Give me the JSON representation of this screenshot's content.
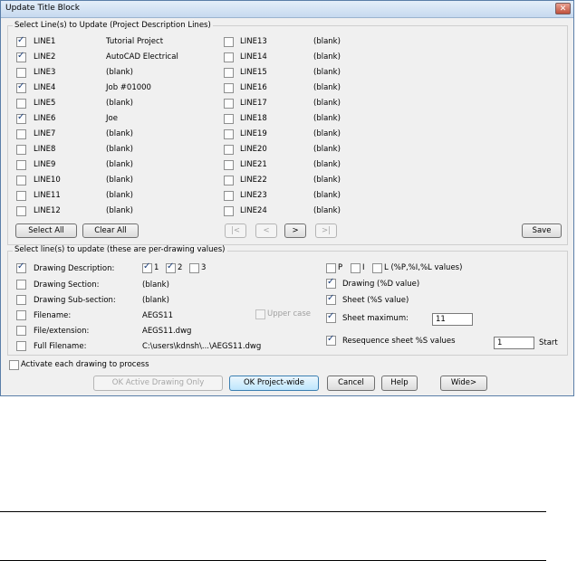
{
  "window": {
    "title": "Update Title Block",
    "close_label": "✕"
  },
  "project_group": {
    "label": "Select Line(s) to Update (Project Description Lines)",
    "left_lines": [
      {
        "name": "LINE1",
        "value": "Tutorial Project",
        "checked": true
      },
      {
        "name": "LINE2",
        "value": "AutoCAD Electrical",
        "checked": true
      },
      {
        "name": "LINE3",
        "value": "(blank)",
        "checked": false
      },
      {
        "name": "LINE4",
        "value": "Job #01000",
        "checked": true
      },
      {
        "name": "LINE5",
        "value": "(blank)",
        "checked": false
      },
      {
        "name": "LINE6",
        "value": "Joe",
        "checked": true
      },
      {
        "name": "LINE7",
        "value": "(blank)",
        "checked": false
      },
      {
        "name": "LINE8",
        "value": "(blank)",
        "checked": false
      },
      {
        "name": "LINE9",
        "value": "(blank)",
        "checked": false
      },
      {
        "name": "LINE10",
        "value": "(blank)",
        "checked": false
      },
      {
        "name": "LINE11",
        "value": "(blank)",
        "checked": false
      },
      {
        "name": "LINE12",
        "value": "(blank)",
        "checked": false
      }
    ],
    "right_lines": [
      {
        "name": "LINE13",
        "value": "(blank)",
        "checked": false
      },
      {
        "name": "LINE14",
        "value": "(blank)",
        "checked": false
      },
      {
        "name": "LINE15",
        "value": "(blank)",
        "checked": false
      },
      {
        "name": "LINE16",
        "value": "(blank)",
        "checked": false
      },
      {
        "name": "LINE17",
        "value": "(blank)",
        "checked": false
      },
      {
        "name": "LINE18",
        "value": "(blank)",
        "checked": false
      },
      {
        "name": "LINE19",
        "value": "(blank)",
        "checked": false
      },
      {
        "name": "LINE20",
        "value": "(blank)",
        "checked": false
      },
      {
        "name": "LINE21",
        "value": "(blank)",
        "checked": false
      },
      {
        "name": "LINE22",
        "value": "(blank)",
        "checked": false
      },
      {
        "name": "LINE23",
        "value": "(blank)",
        "checked": false
      },
      {
        "name": "LINE24",
        "value": "(blank)",
        "checked": false
      }
    ],
    "select_all": "Select All",
    "clear_all": "Clear All",
    "nav": {
      "first": "|<",
      "prev": "<",
      "next": ">",
      "last": ">|"
    },
    "save": "Save"
  },
  "drawing_group": {
    "label": "Select line(s) to update (these are per-drawing values)",
    "rows": [
      {
        "label": "Drawing Description:",
        "value": "",
        "checked": true
      },
      {
        "label": "Drawing Section:",
        "value": "(blank)",
        "checked": false
      },
      {
        "label": "Drawing Sub-section:",
        "value": "(blank)",
        "checked": false
      },
      {
        "label": "Filename:",
        "value": "AEGS11",
        "checked": false
      },
      {
        "label": "File/extension:",
        "value": "AEGS11.dwg",
        "checked": false
      },
      {
        "label": "Full Filename:",
        "value": "C:\\users\\kdnsh\\...\\AEGS11.dwg",
        "checked": false
      }
    ],
    "desc_parts": [
      {
        "label": "1",
        "checked": true
      },
      {
        "label": "2",
        "checked": true
      },
      {
        "label": "3",
        "checked": false
      }
    ],
    "upper_case": "Upper case",
    "pil": [
      {
        "label": "P",
        "checked": false
      },
      {
        "label": "I",
        "checked": false
      },
      {
        "label": "L (%P,%I,%L values)",
        "checked": false
      }
    ],
    "drawing_value": {
      "label": "Drawing (%D value)",
      "checked": true
    },
    "sheet_value": {
      "label": "Sheet (%S value)",
      "checked": true
    },
    "sheet_maximum": {
      "label": "Sheet maximum:",
      "checked": true,
      "value": "11"
    },
    "resequence": {
      "label": "Resequence sheet %S values",
      "checked": true,
      "start_value": "1",
      "start_label": "Start"
    }
  },
  "activate_each": {
    "label": "Activate each drawing to process",
    "checked": false
  },
  "buttons": {
    "ok_active": "OK Active Drawing Only",
    "ok_project": "OK Project-wide",
    "cancel": "Cancel",
    "help": "Help",
    "wide": "Wide>"
  }
}
